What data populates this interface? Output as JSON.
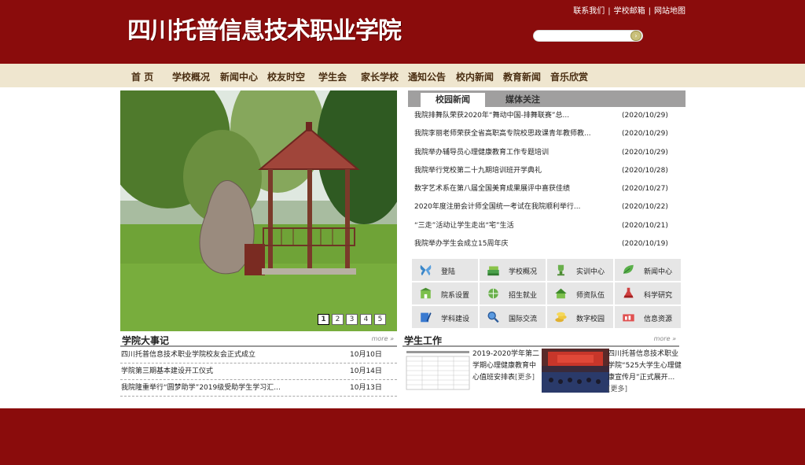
{
  "header": {
    "title": "四川托普信息技术职业学院",
    "top_links": [
      "联系我们",
      "学校邮箱",
      "网站地图"
    ],
    "search_placeholder": ""
  },
  "nav": [
    "首 页",
    "学校概况",
    "新闻中心",
    "校友时空",
    "学生会",
    "家长学校",
    "通知公告",
    "校内新闻",
    "教育新闻",
    "音乐欣赏"
  ],
  "slideshow": {
    "pages": [
      "1",
      "2",
      "3",
      "4",
      "5"
    ],
    "active_page": 1
  },
  "news": {
    "tabs": [
      "校园新闻",
      "媒体关注"
    ],
    "items": [
      {
        "title": "我院排舞队荣获2020年“舞动中国-排舞联赛”总...",
        "date": "(2020/10/29)"
      },
      {
        "title": "我院李丽老师荣获全省高职高专院校思政课青年教师教...",
        "date": "(2020/10/29)"
      },
      {
        "title": "我院举办辅导员心理健康教育工作专题培训",
        "date": "(2020/10/29)"
      },
      {
        "title": "我院举行党校第二十九期培训班开学典礼",
        "date": "(2020/10/28)"
      },
      {
        "title": "数字艺术系在第八届全国美育成果展评中喜获佳绩",
        "date": "(2020/10/27)"
      },
      {
        "title": "2020年度注册会计师全国统一考试在我院顺利举行...",
        "date": "(2020/10/22)"
      },
      {
        "title": "“三走”活动让学生走出“宅”生活",
        "date": "(2020/10/21)"
      },
      {
        "title": "我院举办学生会成立15周年庆",
        "date": "(2020/10/19)"
      }
    ]
  },
  "quick_links": [
    {
      "label": "登陆",
      "icon": "butterfly-icon"
    },
    {
      "label": "学校概况",
      "icon": "books-icon"
    },
    {
      "label": "实训中心",
      "icon": "trophy-icon"
    },
    {
      "label": "新闻中心",
      "icon": "leaf-icon"
    },
    {
      "label": "院系设置",
      "icon": "building-icon"
    },
    {
      "label": "招生就业",
      "icon": "globe-icon"
    },
    {
      "label": "师资队伍",
      "icon": "house-icon"
    },
    {
      "label": "科学研究",
      "icon": "flask-icon"
    },
    {
      "label": "学科建设",
      "icon": "pen-icon"
    },
    {
      "label": "国际交流",
      "icon": "magnifier-icon"
    },
    {
      "label": "数字校园",
      "icon": "coins-icon"
    },
    {
      "label": "信息资源",
      "icon": "chart-icon"
    }
  ],
  "events": {
    "title": "学院大事记",
    "more": "more",
    "items": [
      {
        "title": "四川托普信息技术职业学院校友会正式成立",
        "date": "10月10日"
      },
      {
        "title": "学院第三期基本建设开工仪式",
        "date": "10月14日"
      },
      {
        "title": "我院隆重举行“圆梦助学”2019级受助学生学习汇...",
        "date": "10月13日"
      }
    ]
  },
  "student_work": {
    "title": "学生工作",
    "more": "more",
    "items": [
      {
        "text": "2019-2020学年第二学期心理健康教育中心值班安排表",
        "more": "[更多]"
      },
      {
        "text": "四川托普信息技术职业学院“525大学生心理健康宣传月”正式展开...",
        "more": "[更多]"
      }
    ]
  },
  "colors": {
    "brand": "#8a0c0c",
    "nav_bg": "#efe6cf",
    "tab_bar": "#a09f9f",
    "grid_bg": "#e6e6e6"
  }
}
